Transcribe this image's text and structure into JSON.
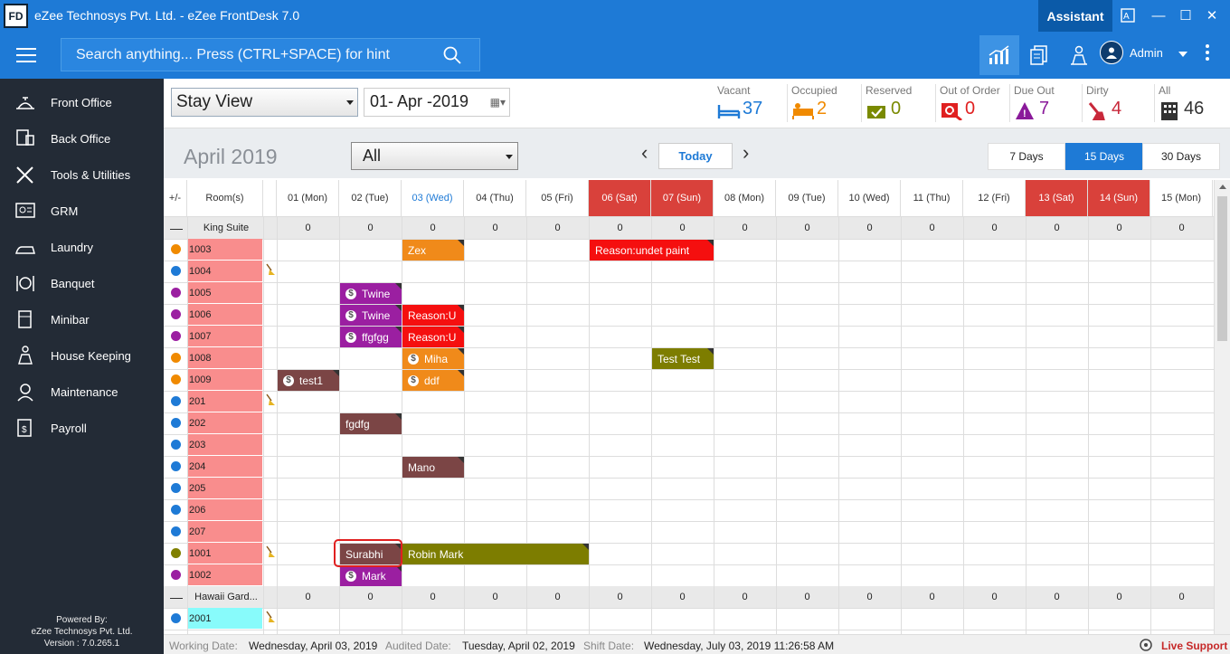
{
  "window": {
    "title": "eZee Technosys Pvt. Ltd. - eZee FrontDesk 7.0",
    "logo": "FD",
    "assistant": "Assistant",
    "minimize": "—",
    "maximize": "☐",
    "close": "✕",
    "translate_icon": "translate-icon"
  },
  "topbar": {
    "search_placeholder": "Search anything... Press (CTRL+SPACE) for hint",
    "user": "Admin"
  },
  "sidebar": {
    "items": [
      {
        "label": "Front Office",
        "icon": "front-office-icon"
      },
      {
        "label": "Back Office",
        "icon": "back-office-icon"
      },
      {
        "label": "Tools & Utilities",
        "icon": "tools-icon"
      },
      {
        "label": "GRM",
        "icon": "grm-icon"
      },
      {
        "label": "Laundry",
        "icon": "laundry-icon"
      },
      {
        "label": "Banquet",
        "icon": "banquet-icon"
      },
      {
        "label": "Minibar",
        "icon": "minibar-icon"
      },
      {
        "label": "House Keeping",
        "icon": "housekeeping-icon"
      },
      {
        "label": "Maintenance",
        "icon": "maintenance-icon"
      },
      {
        "label": "Payroll",
        "icon": "payroll-icon"
      }
    ],
    "powered": [
      "Powered By:",
      "eZee Technosys Pvt. Ltd.",
      "Version : 7.0.265.1"
    ]
  },
  "toolbar": {
    "view": "Stay View",
    "date": "01- Apr -2019"
  },
  "stats": [
    {
      "label": "Vacant",
      "value": "37",
      "color": "#1e7ad6"
    },
    {
      "label": "Occupied",
      "value": "2",
      "color": "#f08a00"
    },
    {
      "label": "Reserved",
      "value": "0",
      "color": "#7a8a00"
    },
    {
      "label": "Out of Order",
      "value": "0",
      "color": "#e02020"
    },
    {
      "label": "Due Out",
      "value": "7",
      "color": "#8a1a9a"
    },
    {
      "label": "Dirty",
      "value": "4",
      "color": "#c8283a"
    },
    {
      "label": "All",
      "value": "46",
      "color": "#333333"
    }
  ],
  "calendar": {
    "month": "April 2019",
    "filter": "All",
    "prev": "‹",
    "next": "›",
    "today": "Today",
    "ranges": [
      "7 Days",
      "15 Days",
      "30 Days"
    ],
    "active_range": "15 Days",
    "header": {
      "toggle": "+/-",
      "rooms": "Room(s)"
    },
    "days": [
      "01 (Mon)",
      "02 (Tue)",
      "03 (Wed)",
      "04 (Thu)",
      "05 (Fri)",
      "06 (Sat)",
      "07 (Sun)",
      "08 (Mon)",
      "09 (Tue)",
      "10 (Wed)",
      "11 (Thu)",
      "12 (Fri)",
      "13 (Sat)",
      "14 (Sun)",
      "15 (Mon)"
    ],
    "weekends": [
      5,
      6,
      12,
      13
    ],
    "today_index": 2,
    "rows": [
      {
        "type": "group",
        "name": "King Suite",
        "counts": [
          "0",
          "0",
          "0",
          "0",
          "0",
          "0",
          "0",
          "0",
          "0",
          "0",
          "0",
          "0",
          "0",
          "0",
          "0"
        ]
      },
      {
        "type": "room",
        "room": "1003",
        "dot": "#f08a00"
      },
      {
        "type": "room",
        "room": "1004",
        "dot": "#1e7ad6",
        "broom": true
      },
      {
        "type": "room",
        "room": "1005",
        "dot": "#9b1fa1"
      },
      {
        "type": "room",
        "room": "1006",
        "dot": "#9b1fa1"
      },
      {
        "type": "room",
        "room": "1007",
        "dot": "#9b1fa1"
      },
      {
        "type": "room",
        "room": "1008",
        "dot": "#f08a00"
      },
      {
        "type": "room",
        "room": "1009",
        "dot": "#f08a00"
      },
      {
        "type": "room",
        "room": "201",
        "dot": "#1e7ad6",
        "broom": true
      },
      {
        "type": "room",
        "room": "202",
        "dot": "#1e7ad6"
      },
      {
        "type": "room",
        "room": "203",
        "dot": "#1e7ad6"
      },
      {
        "type": "room",
        "room": "204",
        "dot": "#1e7ad6"
      },
      {
        "type": "room",
        "room": "205",
        "dot": "#1e7ad6"
      },
      {
        "type": "room",
        "room": "206",
        "dot": "#1e7ad6"
      },
      {
        "type": "room",
        "room": "207",
        "dot": "#1e7ad6"
      },
      {
        "type": "room",
        "room": "1001",
        "dot": "#808000",
        "broom": true
      },
      {
        "type": "room",
        "room": "1002",
        "dot": "#9b1fa1"
      },
      {
        "type": "group",
        "name": "Hawaii Gard...",
        "counts": [
          "0",
          "0",
          "0",
          "0",
          "0",
          "0",
          "0",
          "0",
          "0",
          "0",
          "0",
          "0",
          "0",
          "0",
          "0"
        ]
      },
      {
        "type": "room",
        "room": "2001",
        "dot": "#1e7ad6",
        "broom": true,
        "cyan": true
      }
    ],
    "bookings": [
      {
        "row": 1,
        "start": 2,
        "span": 1,
        "label": "Zex",
        "color": "#f08a1a",
        "dollar": false
      },
      {
        "row": 1,
        "start": 5,
        "span": 2,
        "label": "Reason:undet paint",
        "color": "#f50f0f",
        "dollar": false
      },
      {
        "row": 3,
        "start": 1,
        "span": 1,
        "label": "Twine",
        "color": "#9b1fa1",
        "dollar": true
      },
      {
        "row": 4,
        "start": 1,
        "span": 1,
        "label": "Twine",
        "color": "#9b1fa1",
        "dollar": true
      },
      {
        "row": 4,
        "start": 2,
        "span": 1,
        "label": "Reason:U",
        "color": "#f50f0f",
        "dollar": false
      },
      {
        "row": 5,
        "start": 1,
        "span": 1,
        "label": "ffgfgg",
        "color": "#9b1fa1",
        "dollar": true
      },
      {
        "row": 5,
        "start": 2,
        "span": 1,
        "label": "Reason:U",
        "color": "#f50f0f",
        "dollar": false
      },
      {
        "row": 6,
        "start": 2,
        "span": 1,
        "label": "Miha",
        "color": "#f08a1a",
        "dollar": true
      },
      {
        "row": 6,
        "start": 6,
        "span": 1,
        "label": "Test Test",
        "color": "#7d7d00",
        "dollar": false
      },
      {
        "row": 7,
        "start": 0,
        "span": 1,
        "label": "test1",
        "color": "#7b4545",
        "dollar": true
      },
      {
        "row": 7,
        "start": 2,
        "span": 1,
        "label": "ddf",
        "color": "#f08a1a",
        "dollar": true
      },
      {
        "row": 9,
        "start": 1,
        "span": 1,
        "label": "fgdfg",
        "color": "#7b4545",
        "dollar": false
      },
      {
        "row": 11,
        "start": 2,
        "span": 1,
        "label": "Mano",
        "color": "#7b4545",
        "dollar": false
      },
      {
        "row": 15,
        "start": 1,
        "span": 1,
        "label": "Surabhi",
        "color": "#7b4545",
        "dollar": false
      },
      {
        "row": 15,
        "start": 2,
        "span": 3,
        "label": "Robin Mark",
        "color": "#7d7d00",
        "dollar": false
      },
      {
        "row": 16,
        "start": 1,
        "span": 1,
        "label": "Mark",
        "color": "#9b1fa1",
        "dollar": true
      }
    ],
    "highlight": {
      "row": 15,
      "start": 1,
      "span": 1
    }
  },
  "footer": {
    "working_label": "Working Date:",
    "working": "Wednesday, April 03, 2019",
    "audited_label": "Audited Date:",
    "audited": "Tuesday, April 02, 2019",
    "shift_label": "Shift Date:",
    "shift": "Wednesday, July 03, 2019 11:26:58 AM",
    "live": "Live Support"
  }
}
